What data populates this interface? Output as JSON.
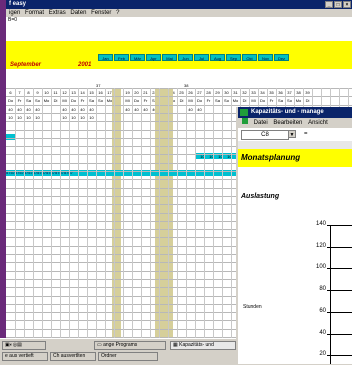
{
  "back_window": {
    "title": "f easy",
    "menu": [
      "igen",
      "Format",
      "Extras",
      "Daten",
      "Fenster",
      "?"
    ],
    "formula_text": "B=0",
    "month_label": "September",
    "year_label": "2001",
    "month_buttons": [
      "Jan",
      "Feb",
      "Mär",
      "Apr",
      "Mai",
      "Jun",
      "Jul",
      "Aug",
      "Sep",
      "Okt",
      "Nov",
      "Dez"
    ],
    "week_numbers": [
      "37",
      "38"
    ],
    "day_numbers": [
      "6",
      "7",
      "8",
      "9",
      "10",
      "11",
      "12",
      "13",
      "14",
      "15",
      "16",
      "17",
      "18",
      "19",
      "20",
      "21",
      "22",
      "23",
      "24",
      "25",
      "26",
      "27",
      "28",
      "29",
      "30",
      "31",
      "32",
      "33",
      "34",
      "35",
      "36",
      "37",
      "38",
      "39"
    ],
    "weekday_labels": [
      "Do",
      "Fr",
      "Sa",
      "So",
      "Mo",
      "Di",
      "Mi",
      "Do",
      "Fr",
      "Sa",
      "So",
      "Mo",
      "Di",
      "Mi",
      "Do",
      "Fr",
      "Sa",
      "So",
      "Mo",
      "Di",
      "Mi",
      "Do",
      "Fr",
      "Sa",
      "So",
      "Mo",
      "Di",
      "Mi",
      "Do",
      "Fr",
      "Sa",
      "So",
      "Mo",
      "Di"
    ],
    "row_values_a": [
      "40",
      "40",
      "40",
      "40",
      "",
      "",
      "40",
      "40",
      "40",
      "40",
      "",
      "",
      "40",
      "40",
      "40",
      "40",
      "40",
      "",
      "",
      "",
      "40",
      "40"
    ],
    "row_values_b": [
      "10",
      "10",
      "10",
      "10",
      "",
      "",
      "10",
      "10",
      "10",
      "10"
    ],
    "cyan_values": [
      "57",
      "57",
      "57",
      "57",
      "57",
      "",
      "",
      "57",
      "57",
      "57",
      "57",
      "57",
      "",
      "",
      "57",
      "57",
      "57",
      "57",
      "57"
    ],
    "right_values": [
      "10",
      "10",
      "10",
      "10"
    ]
  },
  "taskbar": {
    "start_items": [
      "ange Programs"
    ],
    "active_item": "Kapazitäts- und",
    "tray_items": [
      "e aus vertieft",
      "Ch ausvertlten",
      "Ordner"
    ]
  },
  "front_window": {
    "title": "Kapazitäts- und - manage",
    "menu": [
      "Datei",
      "Bearbeiten",
      "Ansicht"
    ],
    "cell_ref": "C8",
    "equals": "=",
    "sheet_title": "Monatsplanung",
    "section_title": "Auslastung",
    "y_axis_label": "Stunden",
    "y_ticks": [
      "140",
      "120",
      "100",
      "80",
      "60",
      "40",
      "20"
    ]
  },
  "colors": {
    "titlebar": "#0a246a",
    "highlight_yellow": "#ffff00",
    "cyan": "#00c0c0",
    "tan": "#d6cf9a",
    "month_text": "#c00000"
  }
}
